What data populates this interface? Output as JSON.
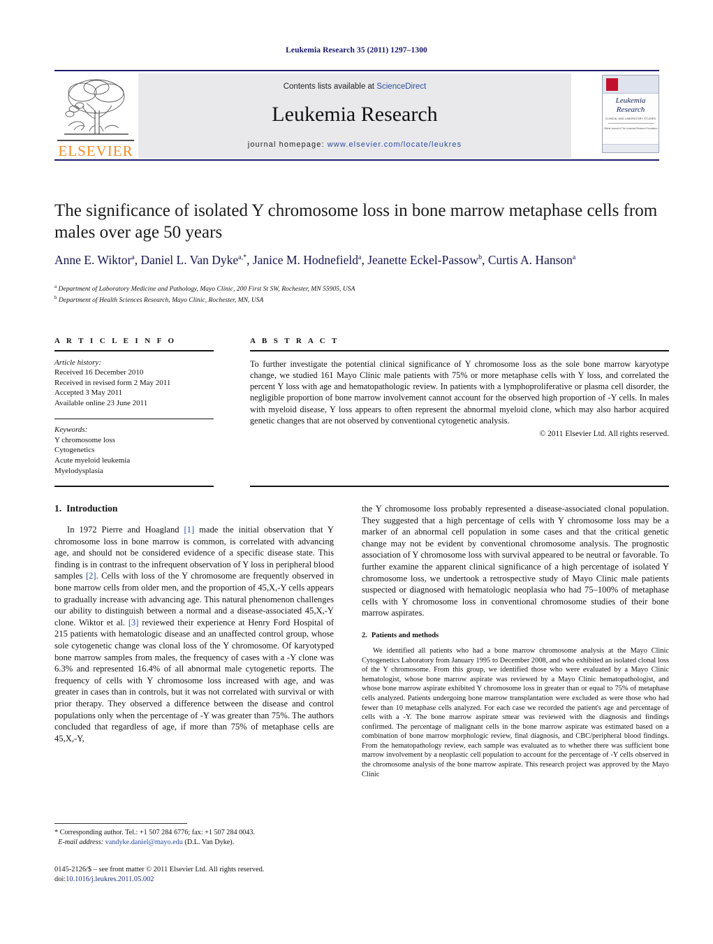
{
  "running_head": "Leukemia Research 35 (2011) 1297–1300",
  "masthead": {
    "publisher_name": "ELSEVIER",
    "contents_prefix": "Contents lists available at ",
    "contents_link": "ScienceDirect",
    "journal_title": "Leukemia Research",
    "homepage_prefix": "journal homepage: ",
    "homepage_url": "www.elsevier.com/locate/leukres",
    "cover": {
      "line1": "Leukemia",
      "line2": "Research",
      "subtitle": "CLINICAL AND LABORATORY STUDIES",
      "blurb": "Official Journal of\nThe Leukemia Research Foundation"
    }
  },
  "article": {
    "title": "The significance of isolated Y chromosome loss in bone marrow metaphase cells from males over age 50 years",
    "authors": [
      {
        "name": "Anne E. Wiktor",
        "marks": "a"
      },
      {
        "name": "Daniel L. Van Dyke",
        "marks": "a,*"
      },
      {
        "name": "Janice M. Hodnefield",
        "marks": "a"
      },
      {
        "name": "Jeanette Eckel-Passow",
        "marks": "b"
      },
      {
        "name": "Curtis A. Hanson",
        "marks": "a"
      }
    ],
    "affiliations": [
      {
        "mark": "a",
        "text": "Department of Laboratory Medicine and Pathology, Mayo Clinic, 200 First St SW, Rochester, MN 55905, USA"
      },
      {
        "mark": "b",
        "text": "Department of Health Sciences Research, Mayo Clinic, Rochester, MN, USA"
      }
    ]
  },
  "info": {
    "heading": "A R T I C L E    I N F O",
    "history_label": "Article history:",
    "history": [
      "Received 16 December 2010",
      "Received in revised form 2 May 2011",
      "Accepted 3 May 2011",
      "Available online 23 June 2011"
    ],
    "keywords_label": "Keywords:",
    "keywords": [
      "Y chromosome loss",
      "Cytogenetics",
      "Acute myeloid leukemia",
      "Myelodysplasia"
    ]
  },
  "abstract": {
    "heading": "A B S T R A C T",
    "text": "To further investigate the potential clinical significance of Y chromosome loss as the sole bone marrow karyotype change, we studied 161 Mayo Clinic male patients with 75% or more metaphase cells with Y loss, and correlated the percent Y loss with age and hematopathologic review. In patients with a lymphoproliferative or plasma cell disorder, the negligible proportion of bone marrow involvement cannot account for the observed high proportion of -Y cells. In males with myeloid disease, Y loss appears to often represent the abnormal myeloid clone, which may also harbor acquired genetic changes that are not observed by conventional cytogenetic analysis.",
    "copyright": "© 2011 Elsevier Ltd. All rights reserved."
  },
  "sections": {
    "introduction": {
      "number": "1.",
      "title": "Introduction",
      "paragraph_left_1": "In 1972 Pierre and Hoagland ",
      "cite_1": "[1]",
      "paragraph_left_2": " made the initial observation that Y chromosome loss in bone marrow is common, is correlated with advancing age, and should not be considered evidence of a specific disease state. This finding is in contrast to the infrequent observation of Y loss in peripheral blood samples ",
      "cite_2": "[2]",
      "paragraph_left_3": ". Cells with loss of the Y chromosome are frequently observed in bone marrow cells from older men, and the proportion of 45,X,-Y cells appears to gradually increase with advancing age. This natural phenomenon challenges our ability to distinguish between a normal and a disease-associated 45,X,-Y clone. Wiktor et al. ",
      "cite_3": "[3]",
      "paragraph_left_4": " reviewed their experience at Henry Ford Hospital of 215 patients with hematologic disease and an unaffected control group, whose sole cytogenetic change was clonal loss of the Y chromosome. Of karyotyped bone marrow samples from males, the frequency of cases with a -Y clone was 6.3% and represented 16.4% of all abnormal male cytogenetic reports. The frequency of cells with Y chromosome loss increased with age, and was greater in cases than in controls, but it was not correlated with survival or with prior therapy. They observed a difference between the disease and control populations only when the percentage of -Y was greater than 75%. The authors concluded that regardless of age, if more than 75% of metaphase cells are 45,X,-Y,",
      "paragraph_right": "the Y chromosome loss probably represented a disease-associated clonal population. They suggested that a high percentage of cells with Y chromosome loss may be a marker of an abnormal cell population in some cases and that the critical genetic change may not be evident by conventional chromosome analysis. The prognostic association of Y chromosome loss with survival appeared to be neutral or favorable. To further examine the apparent clinical significance of a high percentage of isolated Y chromosome loss, we undertook a retrospective study of Mayo Clinic male patients suspected or diagnosed with hematologic neoplasia who had 75–100% of metaphase cells with Y chromosome loss in conventional chromosome studies of their bone marrow aspirates."
    },
    "methods": {
      "number": "2.",
      "title": "Patients and methods",
      "paragraph": "We identified all patients who had a bone marrow chromosome analysis at the Mayo Clinic Cytogenetics Laboratory from January 1995 to December 2008, and who exhibited an isolated clonal loss of the Y chromosome. From this group, we identified those who were evaluated by a Mayo Clinic hematologist, whose bone marrow aspirate was reviewed by a Mayo Clinic hematopathologist, and whose bone marrow aspirate exhibited Y chromosome loss in greater than or equal to 75% of metaphase cells analyzed. Patients undergoing bone marrow transplantation were excluded as were those who had fewer than 10 metaphase cells analyzed. For each case we recorded the patient's age and percentage of cells with a -Y. The bone marrow aspirate smear was reviewed with the diagnosis and findings confirmed. The percentage of malignant cells in the bone marrow aspirate was estimated based on a combination of bone marrow morphologic review, final diagnosis, and CBC/peripheral blood findings. From the hematopathology review, each sample was evaluated as to whether there was sufficient bone marrow involvement by a neoplastic cell population to account for the percentage of -Y cells observed in the chromosome analysis of the bone marrow aspirate. This research project was approved by the Mayo Clinic"
    }
  },
  "footnotes": {
    "corresponding": "* Corresponding author. Tel.: +1 507 284 6776; fax: +1 507 284 0043.",
    "email_label": "E-mail address:",
    "email": "vandyke.daniel@mayo.edu",
    "email_suffix": " (D.L. Van Dyke)."
  },
  "footer": {
    "issn_line": "0145-2126/$ – see front matter © 2011 Elsevier Ltd. All rights reserved.",
    "doi_prefix": "doi:",
    "doi": "10.1016/j.leukres.2011.05.002"
  }
}
